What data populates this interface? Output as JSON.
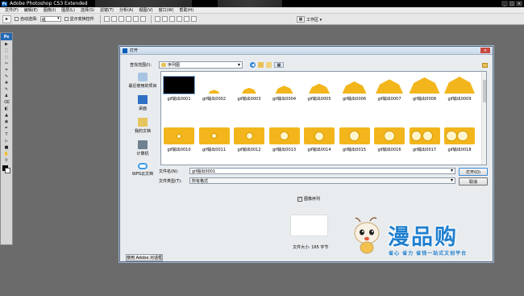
{
  "app": {
    "title": "Adobe Photoshop CS3 Extended",
    "logo_text": "Ps",
    "window_buttons": [
      "_",
      "□",
      "×"
    ]
  },
  "menu": [
    "文件(F)",
    "编辑(E)",
    "图像(I)",
    "图层(L)",
    "选择(S)",
    "滤镜(T)",
    "分析(A)",
    "视图(V)",
    "窗口(W)",
    "帮助(H)"
  ],
  "options_bar": {
    "auto_select_label": "自动选择:",
    "auto_select_value": "组",
    "show_transform_label": "显示变换控件",
    "workspace_label": "工作区 ▾"
  },
  "toolbox": {
    "header": "Ps",
    "tools": [
      "▶",
      "⬚",
      "◌",
      "✂",
      "⌗",
      "✎",
      "✚",
      "✎",
      "♟",
      "⌫",
      "◧",
      "▲",
      "◉",
      "✒",
      "T",
      "▷",
      "■",
      "✋",
      "⚲"
    ]
  },
  "dialog": {
    "title": "打开",
    "close_label": "×",
    "look_in_label": "查找范围(I):",
    "look_in_value": "序列图",
    "places": [
      {
        "label": "最近使用的项目",
        "icon": "recent-items-icon"
      },
      {
        "label": "桌面",
        "icon": "desktop-icon"
      },
      {
        "label": "我的文档",
        "icon": "documents-icon"
      },
      {
        "label": "计算机",
        "icon": "computer-icon"
      },
      {
        "label": "WPS云文档",
        "icon": "cloud-icon"
      }
    ],
    "files": [
      "gif输出0001",
      "gif输出0002",
      "gif输出0003",
      "gif输出0004",
      "gif输出0005",
      "gif输出0006",
      "gif输出0007",
      "gif输出0008",
      "gif输出0009",
      "gif输出0010",
      "gif输出0011",
      "gif输出0012",
      "gif输出0013",
      "gif输出0014",
      "gif输出0015",
      "gif输出0016",
      "gif输出0017",
      "gif输出0018"
    ],
    "file_name_label": "文件名(N):",
    "file_name_value": "gif输出0001",
    "file_type_label": "文件类型(T):",
    "file_type_value": "所有格式",
    "open_button": "打开(O)",
    "cancel_button": "取消",
    "image_sequence_label": "图像序列",
    "image_sequence_checked": "✓",
    "file_size": "文件大小: 165 字节",
    "use_adobe_dialog": "使用 Adobe 对话框"
  },
  "watermark": {
    "brand": "漫品购",
    "slogan": "省心 省力 省钱一站式文创平台"
  },
  "colors": {
    "accent_yellow": "#f2b61c",
    "brand_blue": "#1f7fcf",
    "ps_blue": "#0a5db6"
  }
}
